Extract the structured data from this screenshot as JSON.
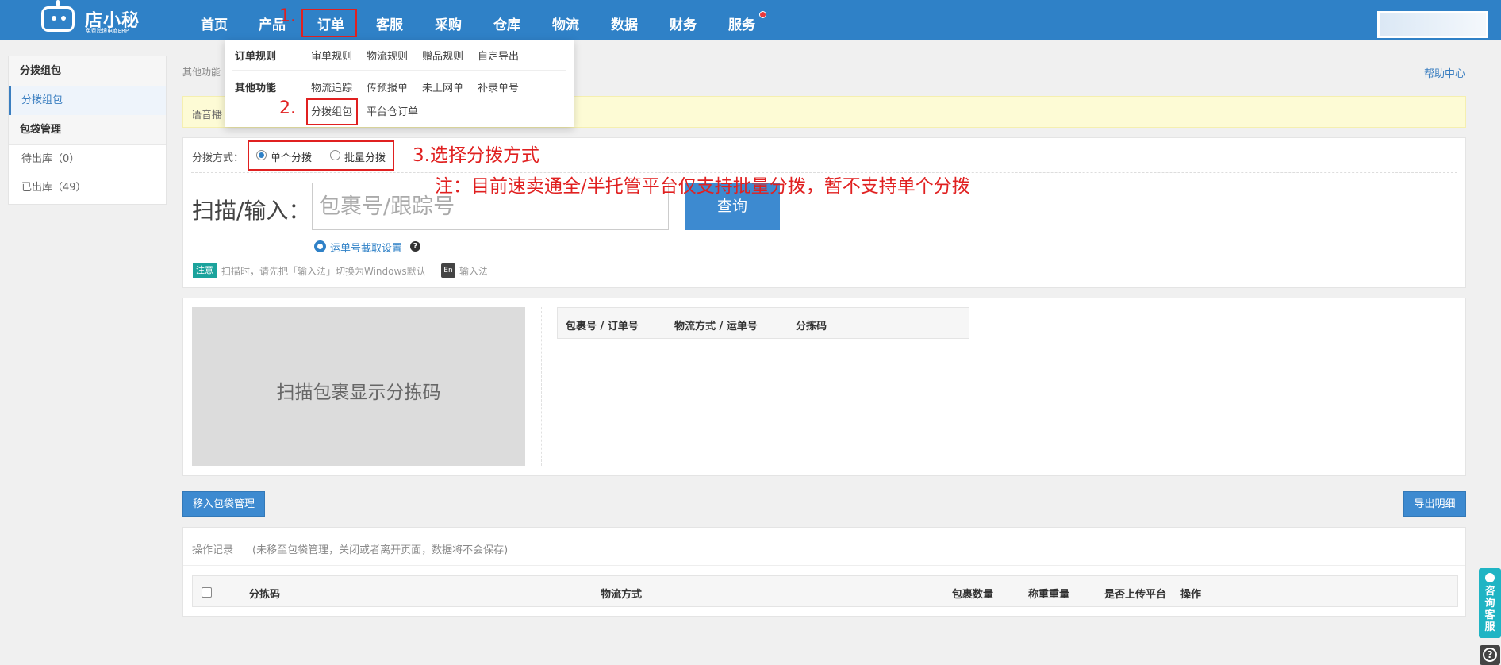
{
  "logo": {
    "name": "店小秘",
    "sub": "免费跨境电商ERP"
  },
  "nav": {
    "items": [
      "首页",
      "产品",
      "订单",
      "客服",
      "采购",
      "仓库",
      "物流",
      "数据",
      "财务",
      "服务"
    ]
  },
  "dropdown": {
    "groups": [
      {
        "title": "订单规则",
        "items": [
          "审单规则",
          "物流规则",
          "赠品规则",
          "自定导出"
        ]
      },
      {
        "title": "其他功能",
        "items": [
          "物流追踪",
          "传预报单",
          "未上网单",
          "补录单号",
          "分拨组包",
          "平台仓订单"
        ]
      }
    ]
  },
  "annotations": {
    "step1": "1.",
    "step2": "2.",
    "step3": "3.选择分拨方式",
    "note": "注：目前速卖通全/半托管平台仅支持批量分拨，暂不支持单个分拨"
  },
  "sidebar": {
    "group1": "分拨组包",
    "item1": "分拨组包",
    "group2": "包袋管理",
    "item2": "待出库（0）",
    "item3": "已出库（49）"
  },
  "breadcrumb": "其他功能",
  "help_center": "帮助中心",
  "notice": "语音播",
  "scan": {
    "method_label": "分拨方式：",
    "option_single": "单个分拨",
    "option_batch": "批量分拨",
    "selected": "单个分拨",
    "label": "扫描/输入：",
    "placeholder": "包裹号/跟踪号",
    "query": "查询",
    "cut_setting": "运单号截取设置",
    "tag": "注意",
    "tip_before": "扫描时，请先把「输入法」切换为Windows默认",
    "en_badge": "En",
    "tip_after": "输入法"
  },
  "result": {
    "display_text": "扫描包裹显示分拣码",
    "columns": [
      "包裹号 / 订单号",
      "物流方式 / 运单号",
      "分拣码"
    ]
  },
  "actions": {
    "move": "移入包袋管理",
    "export": "导出明细"
  },
  "log": {
    "label": "操作记录",
    "note": "(未移至包袋管理，关闭或者离开页面，数据将不会保存)",
    "columns": [
      "分拣码",
      "物流方式",
      "包裹数量",
      "称重重量",
      "是否上传平台",
      "操作"
    ]
  },
  "float_service": "咨询客服",
  "float_help": "?"
}
